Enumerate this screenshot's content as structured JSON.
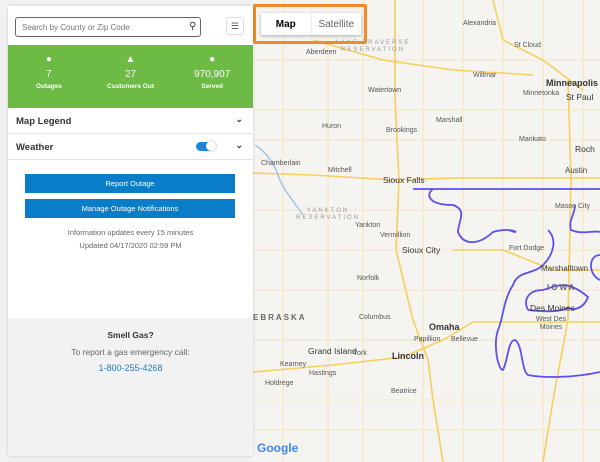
{
  "search": {
    "placeholder": "Search by County or Zip Code",
    "icon": "search-icon"
  },
  "list_button": {
    "icon": "list-icon"
  },
  "stats": [
    {
      "icon": "outage-icon",
      "value": "7",
      "label": "Outages"
    },
    {
      "icon": "warning-icon",
      "value": "27",
      "label": "Customers Out"
    },
    {
      "icon": "person-icon",
      "value": "970,907",
      "label": "Served"
    }
  ],
  "sections": {
    "map_legend": "Map Legend",
    "weather": "Weather",
    "weather_toggle_on": true
  },
  "buttons": {
    "report": "Report Outage",
    "manage": "Manage Outage Notifications"
  },
  "info": {
    "frequency": "Information updates every 15 minutes",
    "updated": "Updated 04/17/2020 02:59 PM"
  },
  "gas": {
    "title": "Smell Gas?",
    "subtitle": "To report a gas emergency call:",
    "phone": "1-800-255-4268"
  },
  "map": {
    "toggle": {
      "map": "Map",
      "satellite": "Satellite",
      "selected": "Map"
    },
    "google": "Google",
    "colors": {
      "brand_green": "#6dbb45",
      "button_blue": "#0a7dc9",
      "territory": "#5b50f0",
      "highlight": "#f08a2c"
    },
    "regions": {
      "iowa": "IOWA",
      "nebraska": "EBRASKA",
      "lake_traverse": "LAKE TRAVERSE RESERVATION",
      "yankton": "YANKTON RESERVATION"
    },
    "cities": {
      "alexandria": "Alexandria",
      "st_cloud": "St Cloud",
      "aberdeen": "Aberdeen",
      "willmar": "Willmar",
      "minneapolis": "Minneapolis",
      "minnetonka": "Minnetonka",
      "st_paul": "St Paul",
      "watertown": "Watertown",
      "marshall": "Marshall",
      "huron": "Huron",
      "brookings": "Brookings",
      "mankato": "Mankato",
      "rochester": "Roch",
      "chamberlain": "Chamberlain",
      "mitchell": "Mitchell",
      "sioux_falls": "Sioux Falls",
      "austin": "Austin",
      "mason_city": "Mason City",
      "yankton": "Yankton",
      "vermillion": "Vermillion",
      "sioux_city": "Sioux City",
      "fort_dodge": "Fort Dodge",
      "norfolk": "Norfolk",
      "marshalltown": "Marshalltown",
      "des_moines": "Des Moines",
      "west_des_moines": "West Des Moines",
      "columbus": "Columbus",
      "omaha": "Omaha",
      "papillion": "Papillion",
      "bellevue": "Bellevue",
      "grand_island": "Grand Island",
      "york": "York",
      "lincoln": "Lincoln",
      "kearney": "Kearney",
      "hastings": "Hastings",
      "holdrege": "Holdrege",
      "beatrice": "Beatrice"
    }
  }
}
